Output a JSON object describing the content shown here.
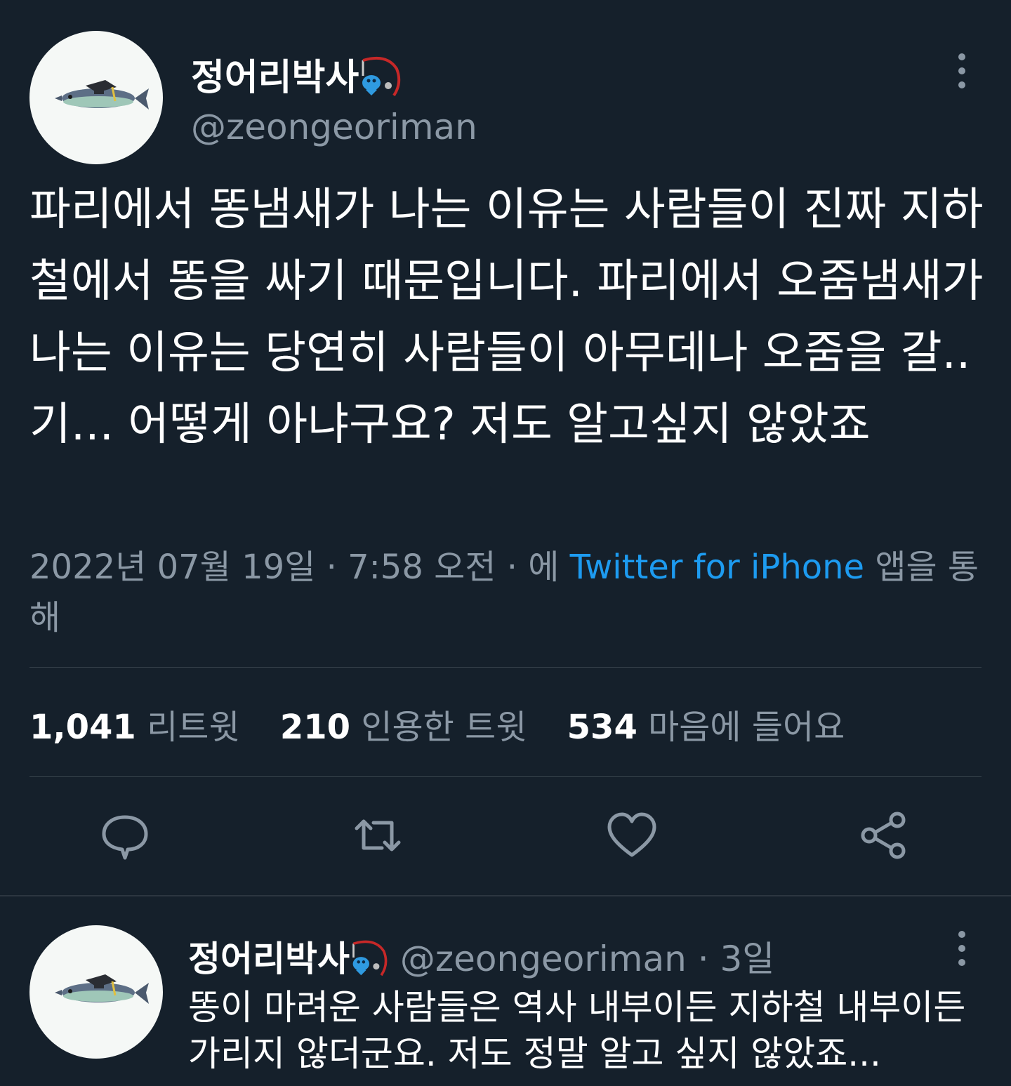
{
  "tweet": {
    "display_name": "정어리박사",
    "handle": "@zeongeoriman",
    "text": "파리에서 똥냄새가 나는 이유는 사람들이 진짜 지하철에서 똥을 싸기 때문입니다. 파리에서 오줌냄새가 나는 이유는 당연히 사람들이 아무데나 오줌을 갈..기... 어떻게 아냐구요? 저도 알고싶지 않았죠",
    "timestamp": "2022년 07월 19일 · 7:58 오전 · 에",
    "source_app": "Twitter for iPhone",
    "source_suffix": "앱을 통해",
    "stats": {
      "retweets_count": "1,041",
      "retweets_label": "리트윗",
      "quotes_count": "210",
      "quotes_label": "인용한 트윗",
      "likes_count": "534",
      "likes_label": "마음에 들어요"
    },
    "actions": [
      "reply-icon",
      "retweet-icon",
      "like-icon",
      "share-icon"
    ]
  },
  "reply": {
    "display_name": "정어리박사",
    "handle": "@zeongeoriman",
    "time": "· 3일",
    "text": "똥이 마려운 사람들은 역사 내부이든 지하철 내부이든 가리지 않더군요. 저도 정말 알고 싶지 않았죠..."
  },
  "colors": {
    "background": "#15202b",
    "text": "#ffffff",
    "secondary": "#8b98a5",
    "link": "#1d9bf0",
    "divider": "#38444d"
  }
}
